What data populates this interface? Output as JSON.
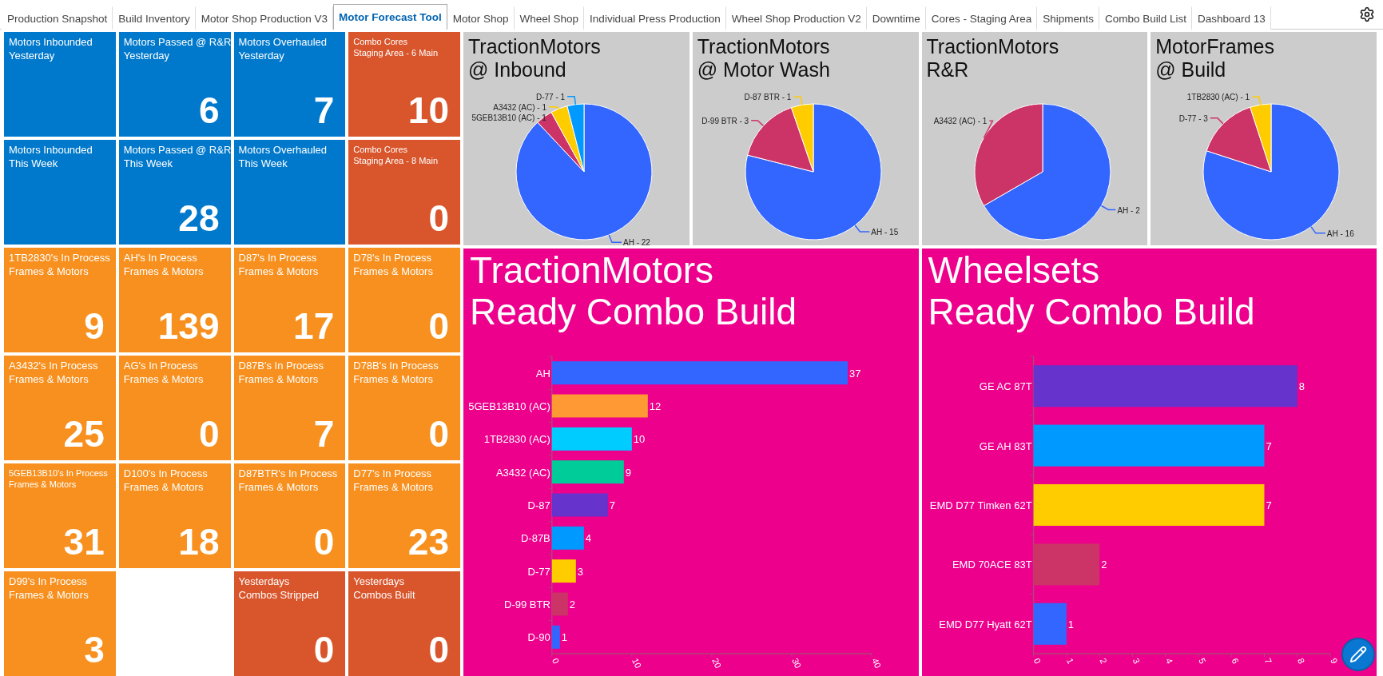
{
  "tabs": [
    {
      "label": "Production Snapshot",
      "selected": false
    },
    {
      "label": "Build Inventory",
      "selected": false
    },
    {
      "label": "Motor Shop Production V3",
      "selected": false
    },
    {
      "label": "Motor Forecast Tool",
      "selected": true
    },
    {
      "label": "Motor Shop",
      "selected": false
    },
    {
      "label": "Wheel Shop",
      "selected": false
    },
    {
      "label": "Individual Press Production",
      "selected": false
    },
    {
      "label": "Wheel Shop Production V2",
      "selected": false
    },
    {
      "label": "Downtime",
      "selected": false
    },
    {
      "label": "Cores - Staging Area",
      "selected": false
    },
    {
      "label": "Shipments",
      "selected": false
    },
    {
      "label": "Combo Build List",
      "selected": false
    },
    {
      "label": "Dashboard 13",
      "selected": false
    }
  ],
  "tiles": [
    {
      "kind": "metric",
      "color": "#0079cc",
      "label": [
        "Motors Inbounded",
        "Yesterday"
      ]
    },
    {
      "kind": "metric",
      "color": "#0079cc",
      "label": [
        "Motors Passed @ R&R",
        "Yesterday"
      ],
      "value": "6"
    },
    {
      "kind": "metric",
      "color": "#0079cc",
      "label": [
        "Motors Overhauled",
        "Yesterday"
      ],
      "value": "7"
    },
    {
      "kind": "metric",
      "color": "#d9552b",
      "label": [
        "Combo Cores",
        "Staging Area - 6 Main"
      ],
      "value": "10"
    },
    {
      "kind": "metric",
      "color": "#0079cc",
      "label": [
        "Motors Inbounded",
        "This Week"
      ]
    },
    {
      "kind": "metric",
      "color": "#0079cc",
      "label": [
        "Motors Passed @ R&R",
        "This Week"
      ],
      "value": "28"
    },
    {
      "kind": "metric",
      "color": "#0079cc",
      "label": [
        "Motors Overhauled",
        "This Week"
      ]
    },
    {
      "kind": "metric",
      "color": "#d9552b",
      "label": [
        "Combo Cores",
        "Staging Area - 8 Main"
      ],
      "value": "0"
    },
    {
      "kind": "metric",
      "color": "#f7901e",
      "label": [
        "1TB2830's In Process",
        "Frames & Motors"
      ],
      "value": "9"
    },
    {
      "kind": "metric",
      "color": "#f7901e",
      "label": [
        "AH's In Process",
        "Frames & Motors"
      ],
      "value": "139"
    },
    {
      "kind": "metric",
      "color": "#f7901e",
      "label": [
        "D87's In Process",
        "Frames & Motors"
      ],
      "value": "17"
    },
    {
      "kind": "metric",
      "color": "#f7901e",
      "label": [
        "D78's In Process",
        "Frames & Motors"
      ],
      "value": "0"
    },
    {
      "kind": "metric",
      "color": "#f7901e",
      "label": [
        "A3432's In Process",
        "Frames & Motors"
      ],
      "value": "25"
    },
    {
      "kind": "metric",
      "color": "#f7901e",
      "label": [
        "AG's In Process",
        "Frames & Motors"
      ],
      "value": "0"
    },
    {
      "kind": "metric",
      "color": "#f7901e",
      "label": [
        "D87B's In Process",
        "Frames & Motors"
      ],
      "value": "7"
    },
    {
      "kind": "metric",
      "color": "#f7901e",
      "label": [
        "D78B's In Process",
        "Frames & Motors"
      ],
      "value": "0"
    },
    {
      "kind": "metric",
      "color": "#f7901e",
      "label": [
        "5GEB13B10's In Process",
        "Frames & Motors"
      ],
      "value": "31"
    },
    {
      "kind": "metric",
      "color": "#f7901e",
      "label": [
        "D100's In Process",
        "Frames & Motors"
      ],
      "value": "18"
    },
    {
      "kind": "metric",
      "color": "#f7901e",
      "label": [
        "D87BTR's In Process",
        "Frames & Motors"
      ],
      "value": "0"
    },
    {
      "kind": "metric",
      "color": "#f7901e",
      "label": [
        "D77's In Process",
        "Frames & Motors"
      ],
      "value": "23"
    },
    {
      "kind": "metric",
      "color": "#f7901e",
      "label": [
        "D99's In Process",
        "Frames & Motors"
      ],
      "value": "3"
    },
    {
      "kind": "blank"
    },
    {
      "kind": "metric",
      "color": "#d9552b",
      "label": [
        "Yesterdays",
        "Combos Stripped"
      ],
      "value": "0"
    },
    {
      "kind": "metric",
      "color": "#d9552b",
      "label": [
        "Yesterdays",
        "Combos Built"
      ],
      "value": "0"
    }
  ],
  "pie_panels": [
    {
      "title": [
        "TractionMotors",
        "@ Inbound"
      ],
      "chart_data": {
        "type": "pie",
        "categories": [
          "AH - 22",
          "5GEB13B10 (AC) - 1",
          "A3432 (AC) - 1",
          "D-77 - 1"
        ],
        "values": [
          88,
          4,
          4,
          4
        ],
        "colors": [
          "#3366ff",
          "#cc3366",
          "#ffcc00",
          "#0099ff"
        ]
      }
    },
    {
      "title": [
        "TractionMotors",
        "@ Motor Wash"
      ],
      "chart_data": {
        "type": "pie",
        "categories": [
          "AH - 15",
          "D-99 BTR - 3",
          "D-87 BTR - 1"
        ],
        "values": [
          78.95,
          15.79,
          5.26
        ],
        "colors": [
          "#3366ff",
          "#cc3366",
          "#ffcc00"
        ]
      }
    },
    {
      "title": [
        "TractionMotors",
        "R&R"
      ],
      "chart_data": {
        "type": "pie",
        "categories": [
          "AH - 2",
          "A3432 (AC) - 1"
        ],
        "values": [
          66.67,
          33.33
        ],
        "colors": [
          "#3366ff",
          "#cc3366"
        ]
      }
    },
    {
      "title": [
        "MotorFrames",
        "@ Build"
      ],
      "chart_data": {
        "type": "pie",
        "categories": [
          "AH - 16",
          "D-77 - 3",
          "1TB2830 (AC) - 1"
        ],
        "values": [
          80,
          15,
          5
        ],
        "colors": [
          "#3366ff",
          "#cc3366",
          "#ffcc00"
        ]
      }
    }
  ],
  "bar_panels": [
    {
      "title": [
        "TractionMotors",
        "Ready Combo Build"
      ],
      "chart_data": {
        "type": "bar",
        "orientation": "horizontal",
        "categories": [
          "AH",
          "5GEB13B10 (AC)",
          "1TB2830 (AC)",
          "A3432 (AC)",
          "D-87",
          "D-87B",
          "D-77",
          "D-99 BTR",
          "D-90"
        ],
        "values": [
          37,
          12,
          10,
          9,
          7,
          4,
          3,
          2,
          1
        ],
        "colors": [
          "#3366ff",
          "#ff9933",
          "#00ccff",
          "#00cc99",
          "#6633cc",
          "#0099ff",
          "#ffcc00",
          "#cc3366",
          "#3366ff"
        ],
        "xlim": [
          0,
          40
        ],
        "xticks": [
          0,
          10,
          20,
          30,
          40
        ],
        "data_labels": true
      }
    },
    {
      "title": [
        "Wheelsets",
        "Ready Combo Build"
      ],
      "chart_data": {
        "type": "bar",
        "orientation": "horizontal",
        "categories": [
          "GE AC 87T",
          "GE AH 83T",
          "EMD D77 Timken 62T",
          "EMD 70ACE 83T",
          "EMD D77 Hyatt 62T"
        ],
        "values": [
          8,
          7,
          7,
          2,
          1
        ],
        "colors": [
          "#6633cc",
          "#0099ff",
          "#ffcc00",
          "#cc3366",
          "#3366ff"
        ],
        "xlim": [
          0,
          9
        ],
        "xticks": [
          0,
          1,
          2,
          3,
          4,
          5,
          6,
          7,
          8,
          9
        ],
        "data_labels": true
      }
    }
  ]
}
